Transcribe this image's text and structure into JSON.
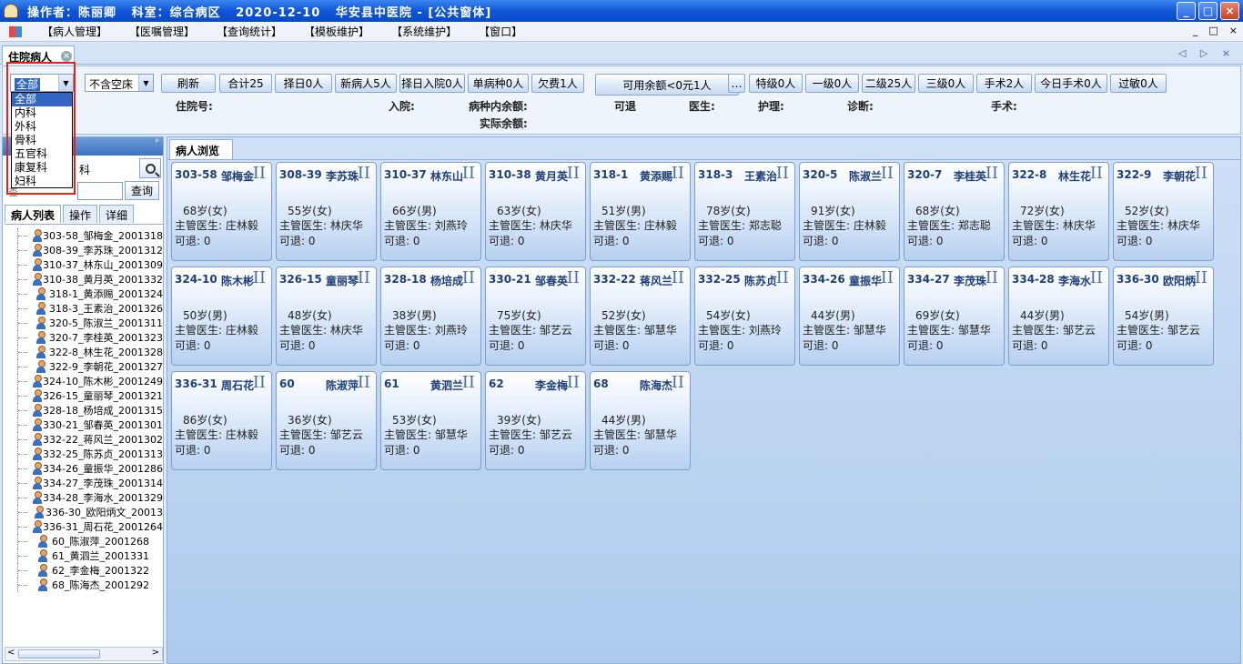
{
  "window": {
    "title": "操作者：陈丽卿   科室：综合病区   2020-12-10   华安县中医院 - [公共窗体]",
    "buttons": [
      "_",
      "□",
      "×"
    ]
  },
  "menu": {
    "items": [
      "【病人管理】",
      "【医嘱管理】",
      "【查询统计】",
      "【模板维护】",
      "【系统维护】",
      "【窗口】"
    ],
    "right_controls": [
      "_",
      "□",
      "×"
    ]
  },
  "doc_tab": {
    "label": "住院病人",
    "nav": "◁ ▷ ×"
  },
  "toolbar": {
    "dept_combo_value": "全部",
    "bed_combo_value": "不含空床",
    "buttons": [
      "刷新",
      "合计25",
      "择日0人",
      "新病人5人",
      "择日入院0人",
      "单病种0人",
      "欠费1人",
      "可用余额<0元1人",
      "…",
      "特级0人",
      "一级0人",
      "二级25人",
      "三级0人",
      "手术2人",
      "今日手术0人",
      "过敏0人"
    ]
  },
  "info_labels": {
    "admission_no": "住院号:",
    "admission": "入院:",
    "disease_balance": "病种内余额:",
    "actual_balance": "实际余额:",
    "refundable": "可退",
    "doctor": "医生:",
    "nursing": "护理:",
    "diagnosis": "诊断:",
    "surgery": "手术:"
  },
  "dept_dropdown": {
    "options": [
      "全部",
      "内科",
      "外科",
      "骨科",
      "五官科",
      "康复科",
      "妇科"
    ],
    "selected": 0
  },
  "left_panel": {
    "pin": "ᵖ",
    "partial_label": "科",
    "partial_text": "查",
    "query_button": "查询",
    "tabs": [
      "病人列表",
      "操作",
      "详细"
    ],
    "patients": [
      "303-58_邹梅金_2001318",
      "308-39_李苏珠_2001312",
      "310-37_林东山_2001309",
      "310-38_黄月英_2001332",
      "318-1_黄添赐_2001324",
      "318-3_王素治_2001326",
      "320-5_陈淑兰_2001311",
      "320-7_李桂英_2001323",
      "322-8_林生花_2001328",
      "322-9_李朝花_2001327",
      "324-10_陈木彬_2001249",
      "326-15_童丽琴_2001321",
      "328-18_杨培成_2001315",
      "330-21_邹春英_2001301",
      "332-22_蒋风兰_2001302",
      "332-25_陈苏贞_2001313",
      "334-26_童振华_2001286",
      "334-27_李茂珠_2001314",
      "334-28_李海水_2001329",
      "336-30_欧阳炳文_20013",
      "336-31_周石花_2001264",
      "60_陈淑萍_2001268",
      "61_黄泗兰_2001331",
      "62_李金梅_2001322",
      "68_陈海杰_2001292"
    ],
    "scroll_left": "<",
    "scroll_right": ">"
  },
  "browse": {
    "tab": "病人浏览",
    "cards": [
      {
        "bed": "303-58",
        "name": "邹梅金",
        "level": "II",
        "age": "68岁(女)",
        "doctor": "主管医生: 庄林毅",
        "refund": "可退: 0"
      },
      {
        "bed": "308-39",
        "name": "李苏珠",
        "level": "II",
        "age": "55岁(女)",
        "doctor": "主管医生: 林庆华",
        "refund": "可退: 0"
      },
      {
        "bed": "310-37",
        "name": "林东山",
        "level": "II",
        "age": "66岁(男)",
        "doctor": "主管医生: 刘燕玲",
        "refund": "可退: 0"
      },
      {
        "bed": "310-38",
        "name": "黄月英",
        "level": "II",
        "age": "63岁(女)",
        "doctor": "主管医生: 林庆华",
        "refund": "可退: 0"
      },
      {
        "bed": "318-1",
        "name": "黄添赐",
        "level": "II",
        "age": "51岁(男)",
        "doctor": "主管医生: 庄林毅",
        "refund": "可退: 0"
      },
      {
        "bed": "318-3",
        "name": "王素治",
        "level": "II",
        "age": "78岁(女)",
        "doctor": "主管医生: 郑志聪",
        "refund": "可退: 0"
      },
      {
        "bed": "320-5",
        "name": "陈淑兰",
        "level": "II",
        "age": "91岁(女)",
        "doctor": "主管医生: 庄林毅",
        "refund": "可退: 0"
      },
      {
        "bed": "320-7",
        "name": "李桂英",
        "level": "II",
        "age": "68岁(女)",
        "doctor": "主管医生: 郑志聪",
        "refund": "可退: 0"
      },
      {
        "bed": "322-8",
        "name": "林生花",
        "level": "II",
        "age": "72岁(女)",
        "doctor": "主管医生: 林庆华",
        "refund": "可退: 0"
      },
      {
        "bed": "322-9",
        "name": "李朝花",
        "level": "II",
        "age": "52岁(女)",
        "doctor": "主管医生: 林庆华",
        "refund": "可退: 0"
      },
      {
        "bed": "324-10",
        "name": "陈木彬",
        "level": "II",
        "age": "50岁(男)",
        "doctor": "主管医生: 庄林毅",
        "refund": "可退: 0"
      },
      {
        "bed": "326-15",
        "name": "童丽琴",
        "level": "II",
        "age": "48岁(女)",
        "doctor": "主管医生: 林庆华",
        "refund": "可退: 0"
      },
      {
        "bed": "328-18",
        "name": "杨培成",
        "level": "II",
        "age": "38岁(男)",
        "doctor": "主管医生: 刘燕玲",
        "refund": "可退: 0"
      },
      {
        "bed": "330-21",
        "name": "邹春英",
        "level": "II",
        "age": "75岁(女)",
        "doctor": "主管医生: 邹艺云",
        "refund": "可退: 0"
      },
      {
        "bed": "332-22",
        "name": "蒋风兰",
        "level": "II",
        "age": "52岁(女)",
        "doctor": "主管医生: 邹慧华",
        "refund": "可退: 0"
      },
      {
        "bed": "332-25",
        "name": "陈苏贞",
        "level": "II",
        "age": "54岁(女)",
        "doctor": "主管医生: 刘燕玲",
        "refund": "可退: 0"
      },
      {
        "bed": "334-26",
        "name": "童振华",
        "level": "II",
        "age": "44岁(男)",
        "doctor": "主管医生: 邹慧华",
        "refund": "可退: 0"
      },
      {
        "bed": "334-27",
        "name": "李茂珠",
        "level": "II",
        "age": "69岁(女)",
        "doctor": "主管医生: 邹慧华",
        "refund": "可退: 0"
      },
      {
        "bed": "334-28",
        "name": "李海水",
        "level": "II",
        "age": "44岁(男)",
        "doctor": "主管医生: 邹艺云",
        "refund": "可退: 0"
      },
      {
        "bed": "336-30",
        "name": "欧阳炳",
        "level": "II",
        "age": "54岁(男)",
        "doctor": "主管医生: 邹艺云",
        "refund": "可退: 0"
      },
      {
        "bed": "336-31",
        "name": "周石花",
        "level": "II",
        "age": "86岁(女)",
        "doctor": "主管医生: 庄林毅",
        "refund": "可退: 0"
      },
      {
        "bed": "60",
        "name": "陈淑萍",
        "level": "II",
        "age": "36岁(女)",
        "doctor": "主管医生: 邹艺云",
        "refund": "可退: 0"
      },
      {
        "bed": "61",
        "name": "黄泗兰",
        "level": "II",
        "age": "53岁(女)",
        "doctor": "主管医生: 邹慧华",
        "refund": "可退: 0"
      },
      {
        "bed": "62",
        "name": "李金梅",
        "level": "II",
        "age": "39岁(女)",
        "doctor": "主管医生: 邹艺云",
        "refund": "可退: 0"
      },
      {
        "bed": "68",
        "name": "陈海杰",
        "level": "II",
        "age": "44岁(男)",
        "doctor": "主管医生: 邹慧华",
        "refund": "可退: 0"
      }
    ]
  }
}
